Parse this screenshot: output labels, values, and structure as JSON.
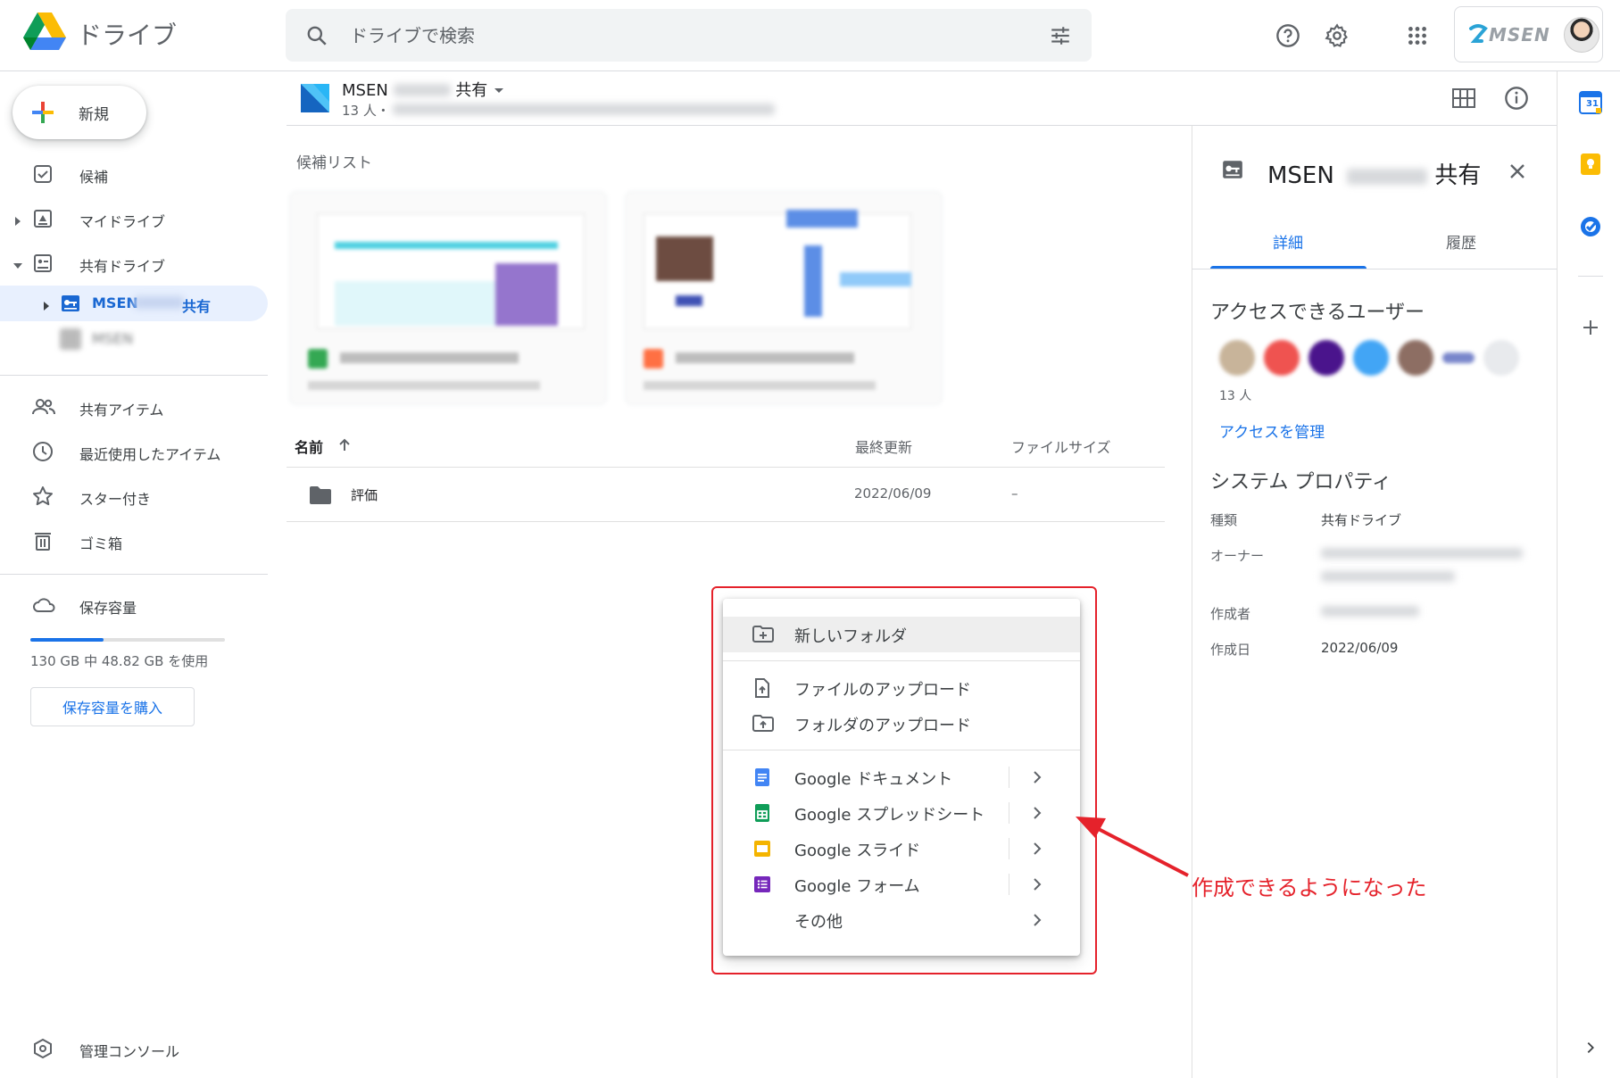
{
  "header": {
    "app_title": "ドライブ",
    "search_placeholder": "ドライブで検索",
    "brand": "MSEN"
  },
  "sidebar": {
    "new_label": "新規",
    "items": [
      {
        "label": "候補",
        "icon": "check-box-icon"
      },
      {
        "label": "マイドライブ",
        "icon": "my-drive-icon"
      },
      {
        "label": "共有ドライブ",
        "icon": "shared-drives-icon"
      },
      {
        "label": "MSEN",
        "label_suffix": "共有",
        "icon": "shared-drive-key-icon",
        "active": true
      },
      {
        "label": "MSEN"
      },
      {
        "label": "共有アイテム",
        "icon": "people-icon"
      },
      {
        "label": "最近使用したアイテム",
        "icon": "clock-icon"
      },
      {
        "label": "スター付き",
        "icon": "star-icon"
      },
      {
        "label": "ゴミ箱",
        "icon": "trash-icon"
      },
      {
        "label": "保存容量",
        "icon": "cloud-icon"
      }
    ],
    "storage_text": "130 GB 中 48.82 GB を使用",
    "storage_used_fraction": 0.3755,
    "buy_storage_label": "保存容量を購入",
    "admin_console_label": "管理コンソール"
  },
  "main": {
    "drive_name": "MSEN",
    "drive_name_suffix": "共有",
    "member_count": "13 人・",
    "suggested_label": "候補リスト",
    "columns": {
      "name": "名前",
      "modified": "最終更新",
      "size": "ファイルサイズ"
    },
    "rows": [
      {
        "name": "評価",
        "modified": "2022/06/09",
        "size": "–"
      }
    ]
  },
  "context_menu": {
    "items": [
      {
        "label": "新しいフォルダ",
        "icon": "new-folder-icon"
      },
      {
        "label": "ファイルのアップロード",
        "icon": "file-upload-icon"
      },
      {
        "label": "フォルダのアップロード",
        "icon": "folder-upload-icon"
      },
      {
        "label": "Google ドキュメント",
        "icon": "google-docs-icon"
      },
      {
        "label": "Google スプレッドシート",
        "icon": "google-sheets-icon"
      },
      {
        "label": "Google スライド",
        "icon": "google-slides-icon"
      },
      {
        "label": "Google フォーム",
        "icon": "google-forms-icon"
      },
      {
        "label": "その他"
      }
    ]
  },
  "annotation": "作成できるようになった",
  "details_panel": {
    "title": "MSEN",
    "title_suffix": "共有",
    "tabs": [
      "詳細",
      "履歴"
    ],
    "access_title": "アクセスできるユーザー",
    "member_count": "13 人",
    "manage_access": "アクセスを管理",
    "system_props_title": "システム プロパティ",
    "props": [
      {
        "label": "種類",
        "value": "共有ドライブ"
      },
      {
        "label": "オーナー",
        "value": ""
      },
      {
        "label": "作成者",
        "value": ""
      },
      {
        "label": "作成日",
        "value": "2022/06/09"
      }
    ]
  },
  "rail": {
    "calendar_day": "31"
  },
  "colors": {
    "accent": "#1a73e8",
    "annotation_red": "#e5222b",
    "active_nav_bg": "#e8f0fe"
  }
}
